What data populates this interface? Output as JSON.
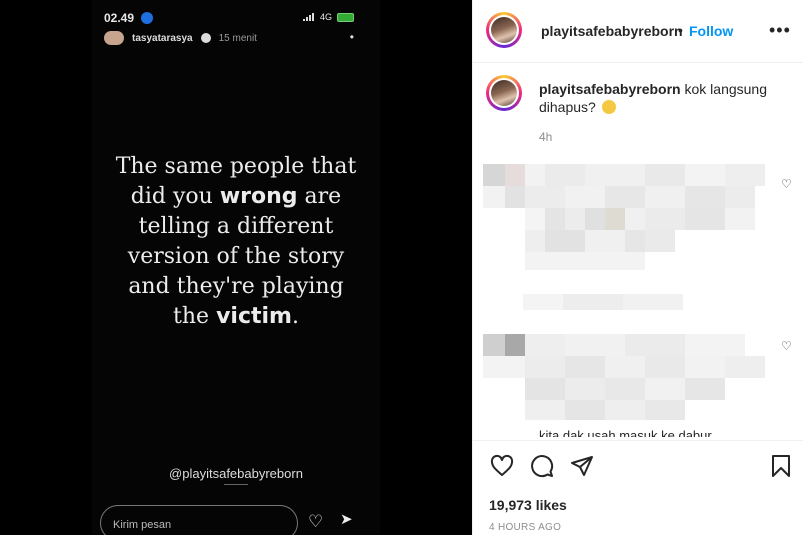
{
  "story": {
    "status_time": "02.49",
    "status_network": "4G",
    "username": "tasyatarasya",
    "time": "15 menit",
    "more_glyph": "•",
    "quote": {
      "line1": "The same people that",
      "line2_pre": "did you ",
      "line2_bold": "wrong",
      "line2_post": " are",
      "line3": "telling a different",
      "line4": "version of the story",
      "line5": "and they're playing",
      "line6_pre": "the ",
      "line6_bold": "victim",
      "line6_post": "."
    },
    "handle": "@playitsafebabyreborn",
    "reply_placeholder": "Kirim pesan",
    "heart_glyph": "♡",
    "send_glyph": "➤"
  },
  "post": {
    "username": "playitsafebabyreborn",
    "separator": "•",
    "follow_label": "Follow",
    "more_glyph": "•••",
    "caption_username": "playitsafebabyreborn",
    "caption_text": "kok langsung dihapus?",
    "caption_time": "4h",
    "comment_heart": "♡",
    "partial_comment_text": "kita dak usah masuk ke dabur",
    "like_glyph": "♡",
    "comment_glyph": "◯",
    "share_glyph": "▷",
    "save_glyph": "▯",
    "likes": "19,973 likes",
    "posted_ago": "4 HOURS AGO"
  },
  "colors": {
    "accent": "#0095f6",
    "text": "#262626",
    "muted": "#8e8e8e"
  }
}
